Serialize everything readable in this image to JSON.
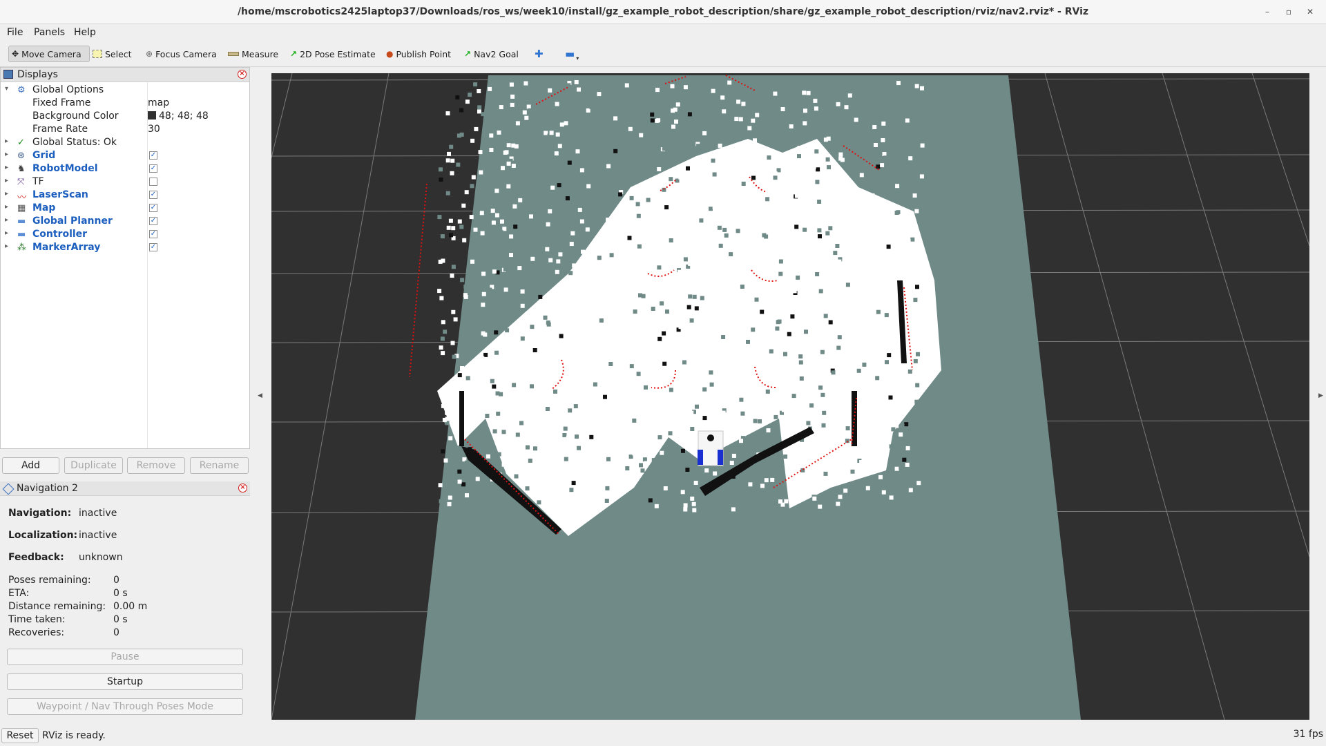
{
  "window": {
    "title": "/home/mscrobotics2425laptop37/Downloads/ros_ws/week10/install/gz_example_robot_description/share/gz_example_robot_description/rviz/nav2.rviz* - RViz",
    "minimize": "–",
    "restore": "▫",
    "close": "✕"
  },
  "menu": {
    "file": "File",
    "panels": "Panels",
    "help": "Help"
  },
  "toolbar": {
    "move_camera": "Move Camera",
    "select": "Select",
    "focus_camera": "Focus Camera",
    "measure": "Measure",
    "pose_estimate": "2D Pose Estimate",
    "publish_point": "Publish Point",
    "nav2_goal": "Nav2 Goal"
  },
  "displays": {
    "title": "Displays",
    "global_options": "Global Options",
    "fixed_frame_label": "Fixed Frame",
    "fixed_frame_value": "map",
    "bg_color_label": "Background Color",
    "bg_color_value": "48; 48; 48",
    "bg_color_swatch": "#303030",
    "frame_rate_label": "Frame Rate",
    "frame_rate_value": "30",
    "global_status": "Global Status: Ok",
    "items": [
      {
        "label": "Grid",
        "checked": true
      },
      {
        "label": "RobotModel",
        "checked": true
      },
      {
        "label": "TF",
        "checked": false
      },
      {
        "label": "LaserScan",
        "checked": true
      },
      {
        "label": "Map",
        "checked": true
      },
      {
        "label": "Global Planner",
        "checked": true
      },
      {
        "label": "Controller",
        "checked": true
      },
      {
        "label": "MarkerArray",
        "checked": true
      }
    ],
    "buttons": {
      "add": "Add",
      "duplicate": "Duplicate",
      "remove": "Remove",
      "rename": "Rename"
    }
  },
  "navigation": {
    "title": "Navigation 2",
    "navigation_label": "Navigation:",
    "navigation_value": "inactive",
    "localization_label": "Localization:",
    "localization_value": "inactive",
    "feedback_label": "Feedback:",
    "feedback_value": "unknown",
    "poses_remaining_label": "Poses remaining:",
    "poses_remaining_value": "0",
    "eta_label": "ETA:",
    "eta_value": "0 s",
    "distance_label": "Distance remaining:",
    "distance_value": "0.00 m",
    "time_label": "Time taken:",
    "time_value": "0 s",
    "recoveries_label": "Recoveries:",
    "recoveries_value": "0",
    "pause": "Pause",
    "startup": "Startup",
    "waypoint": "Waypoint / Nav Through Poses Mode"
  },
  "status": {
    "reset": "Reset",
    "message": "RViz is ready.",
    "fps": "31 fps"
  },
  "colors": {
    "render_bg": "#303030",
    "map_unknown": "#6f8a87",
    "free": "#ffffff",
    "laser": "#e01010",
    "robot_body": "#f4f4f4",
    "robot_wheels": "#1a2fd0"
  }
}
